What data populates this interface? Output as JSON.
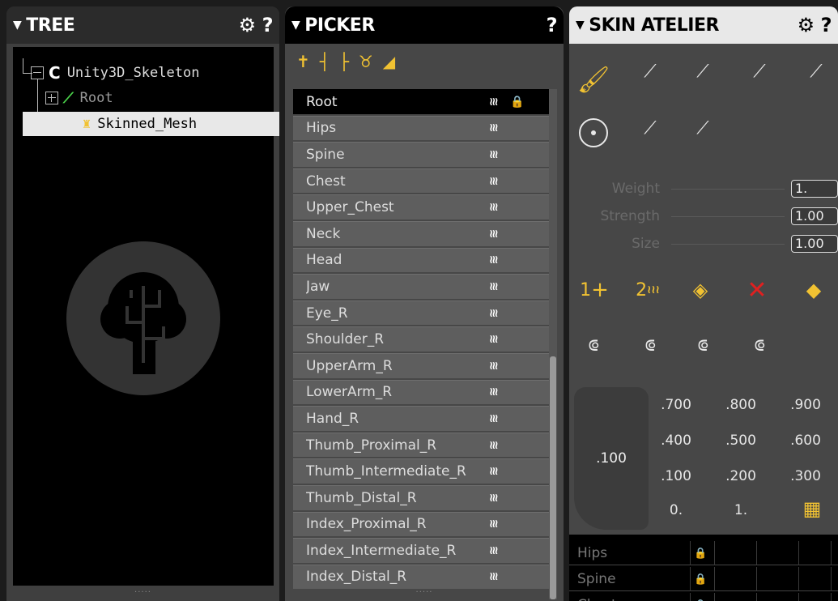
{
  "tree": {
    "title": "TREE",
    "settings_icon": "gear-icon",
    "help_label": "?",
    "items": [
      {
        "label": "Unity3D_Skeleton",
        "icon": "skeleton-icon"
      },
      {
        "label": "Root",
        "icon": "bone-icon"
      },
      {
        "label": "Skinned_Mesh",
        "icon": "mesh-icon"
      }
    ],
    "footer": "....."
  },
  "picker": {
    "title": "PICKER",
    "help_label": "?",
    "tool_icons": [
      "bone-picker-icon",
      "bone-child-icon",
      "bone-branch-icon",
      "x-ray-icon",
      "flat-icon"
    ],
    "bones": [
      {
        "name": "Root",
        "weight": "≀≀≀"
      },
      {
        "name": "Hips",
        "weight": "≀≀≀"
      },
      {
        "name": "Spine",
        "weight": "≀≀≀"
      },
      {
        "name": "Chest",
        "weight": "≀≀≀"
      },
      {
        "name": "Upper_Chest",
        "weight": "≀≀≀"
      },
      {
        "name": "Neck",
        "weight": "≀≀≀"
      },
      {
        "name": "Head",
        "weight": "≀≀≀"
      },
      {
        "name": "Jaw",
        "weight": "≀≀≀"
      },
      {
        "name": "Eye_R",
        "weight": "≀≀≀"
      },
      {
        "name": "Shoulder_R",
        "weight": "≀≀≀"
      },
      {
        "name": "UpperArm_R",
        "weight": "≀≀≀"
      },
      {
        "name": "LowerArm_R",
        "weight": "≀≀≀"
      },
      {
        "name": "Hand_R",
        "weight": "≀≀≀"
      },
      {
        "name": "Thumb_Proximal_R",
        "weight": "≀≀≀"
      },
      {
        "name": "Thumb_Intermediate_R",
        "weight": "≀≀≀"
      },
      {
        "name": "Thumb_Distal_R",
        "weight": "≀≀≀"
      },
      {
        "name": "Index_Proximal_R",
        "weight": "≀≀≀"
      },
      {
        "name": "Index_Intermediate_R",
        "weight": "≀≀≀"
      },
      {
        "name": "Index_Distal_R",
        "weight": "≀≀≀"
      }
    ],
    "footer": "....."
  },
  "skin": {
    "title": "SKIN ATELIER",
    "help_label": "?",
    "params": [
      {
        "label": "Weight",
        "value": "1."
      },
      {
        "label": "Strength",
        "value": "1.00"
      },
      {
        "label": "Size",
        "value": "1.00"
      }
    ],
    "knob_value": ".100",
    "grid": [
      ".700",
      ".800",
      ".900",
      ".400",
      ".500",
      ".600",
      ".100",
      ".200",
      ".300",
      "0.",
      "1."
    ],
    "bone_rows": [
      "Hips",
      "Spine",
      "Chest"
    ],
    "weight_step_1": "1",
    "weight_step_2": "2",
    "weight_step_2_mark": "≀≀≀"
  },
  "colors": {
    "accent_yellow": "#f1c232",
    "panel_bg": "#474747",
    "remove_red": "#e02020",
    "bone_green": "#4cd64c"
  }
}
